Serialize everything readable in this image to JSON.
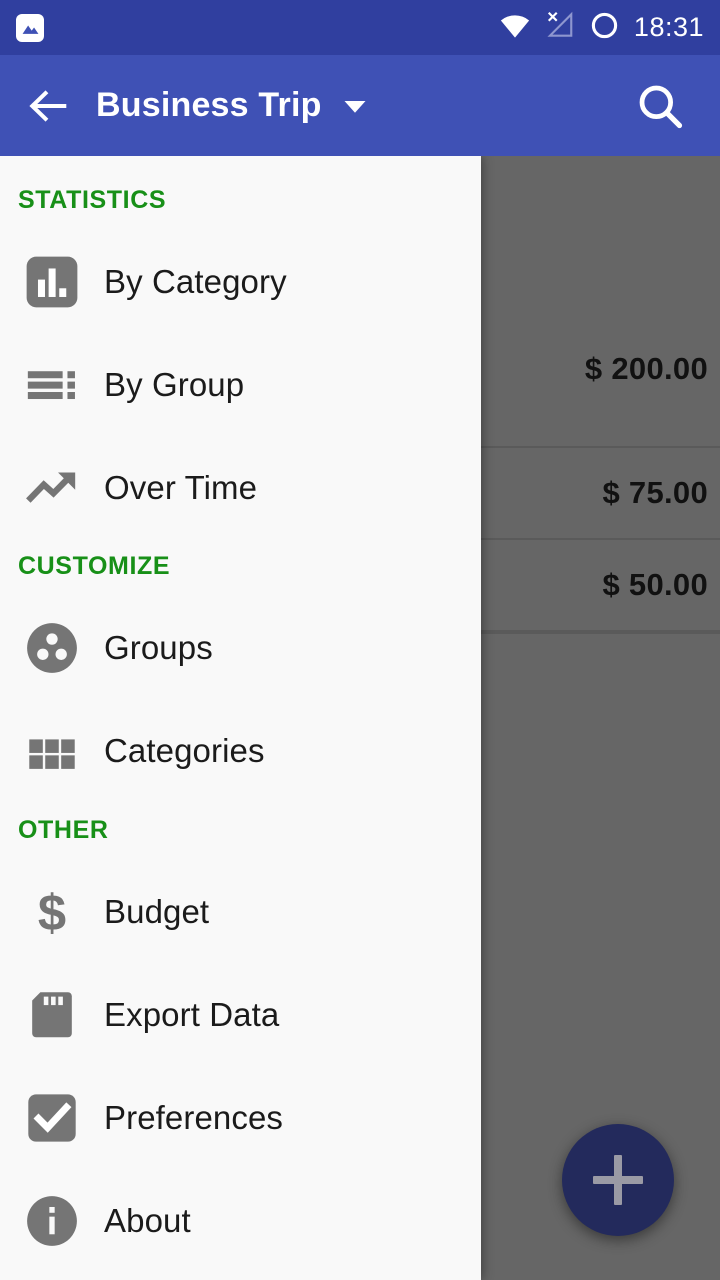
{
  "status_bar": {
    "notification_icon": "screenshot-image-icon",
    "icons": [
      "wifi-icon",
      "no-sim-signal-icon",
      "alarm-ring-icon"
    ],
    "time": "18:31"
  },
  "toolbar": {
    "back_icon": "back-arrow-icon",
    "title": "Business Trip",
    "dropdown_icon": "chevron-down-icon",
    "search_icon": "search-icon",
    "background_color": "#3f51b5"
  },
  "drawer": {
    "background_color": "#f9f9f9",
    "section_color": "#189018",
    "sections": [
      {
        "header": "STATISTICS",
        "items": [
          {
            "label": "By Category",
            "icon": "bar-chart-icon"
          },
          {
            "label": "By Group",
            "icon": "list-sort-icon"
          },
          {
            "label": "Over Time",
            "icon": "trending-up-icon"
          }
        ]
      },
      {
        "header": "CUSTOMIZE",
        "items": [
          {
            "label": "Groups",
            "icon": "group-dots-circle-icon"
          },
          {
            "label": "Categories",
            "icon": "grid-squares-icon"
          }
        ]
      },
      {
        "header": "OTHER",
        "items": [
          {
            "label": "Budget",
            "icon": "dollar-sign-icon"
          },
          {
            "label": "Export Data",
            "icon": "sd-card-icon"
          },
          {
            "label": "Preferences",
            "icon": "checkbox-checked-icon"
          },
          {
            "label": "About",
            "icon": "info-circle-icon"
          }
        ]
      }
    ]
  },
  "content": {
    "dim_color": "#666666",
    "rows": [
      {
        "amount": "$ 200.00"
      },
      {
        "amount": "$ 75.00"
      },
      {
        "amount": "$ 50.00"
      }
    ],
    "fab": {
      "icon": "plus-icon",
      "color": "#232a5c"
    }
  }
}
